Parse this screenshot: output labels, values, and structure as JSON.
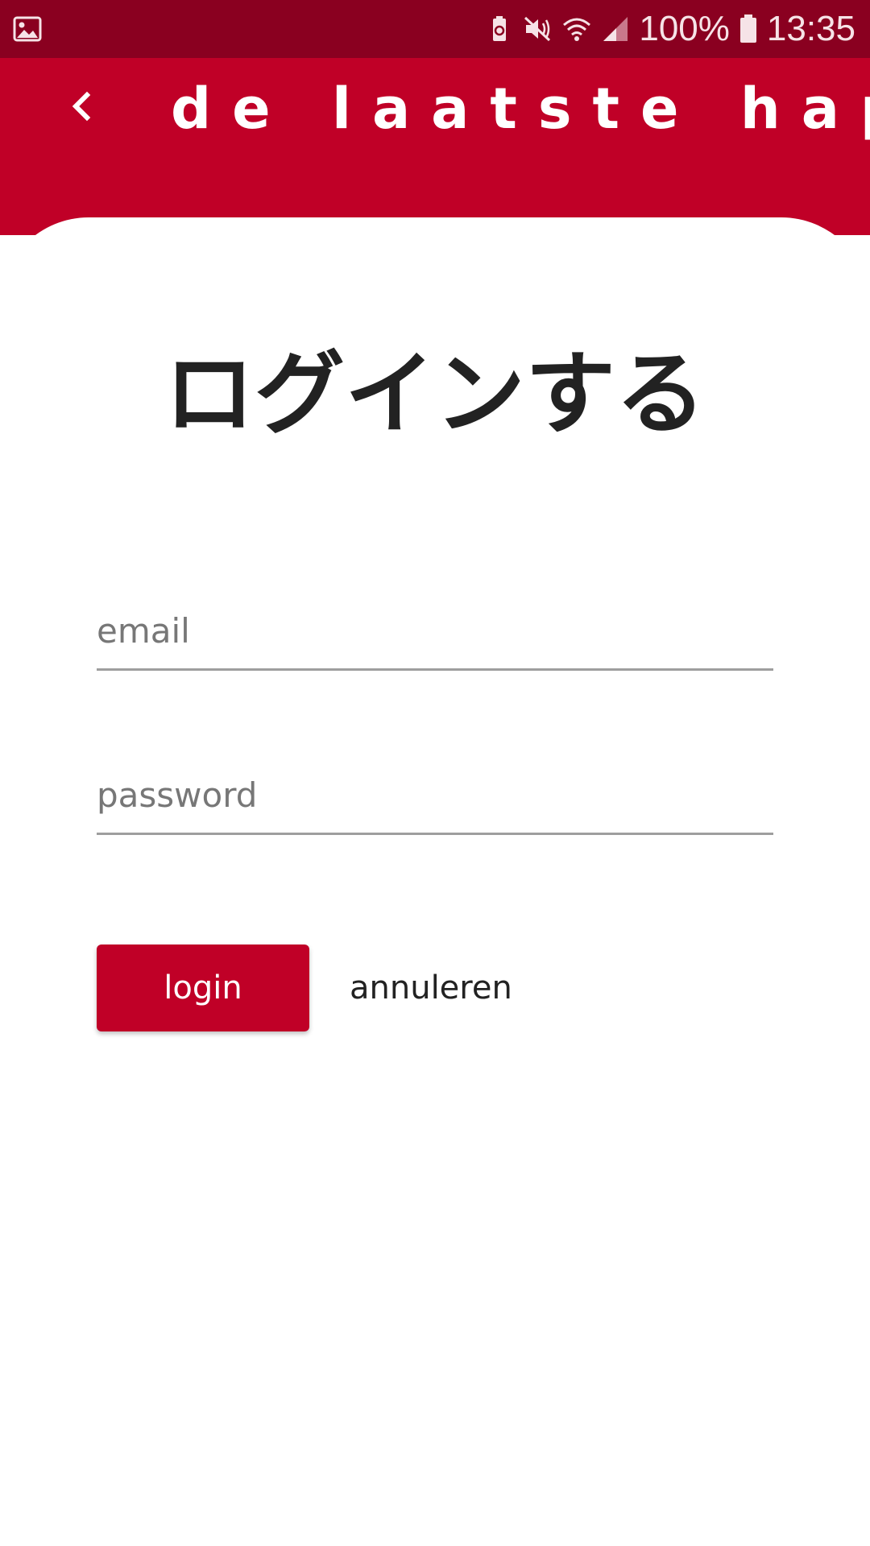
{
  "status_bar": {
    "battery_percent": "100%",
    "time": "13:35",
    "icons": [
      "gallery-icon",
      "battery-saver-icon",
      "mute-icon",
      "wifi-icon",
      "signal-icon",
      "battery-icon"
    ]
  },
  "header": {
    "title": "de laatste hap",
    "back_icon": "chevron-left-icon"
  },
  "login": {
    "title": "ログインする",
    "email_placeholder": "email",
    "email_value": "",
    "password_placeholder": "password",
    "password_value": "",
    "login_label": "login",
    "cancel_label": "annuleren"
  },
  "colors": {
    "status_bar": "#8a0020",
    "brand": "#c00027",
    "title_text": "#222222",
    "placeholder": "#777777",
    "underline": "#9e9e9e"
  }
}
